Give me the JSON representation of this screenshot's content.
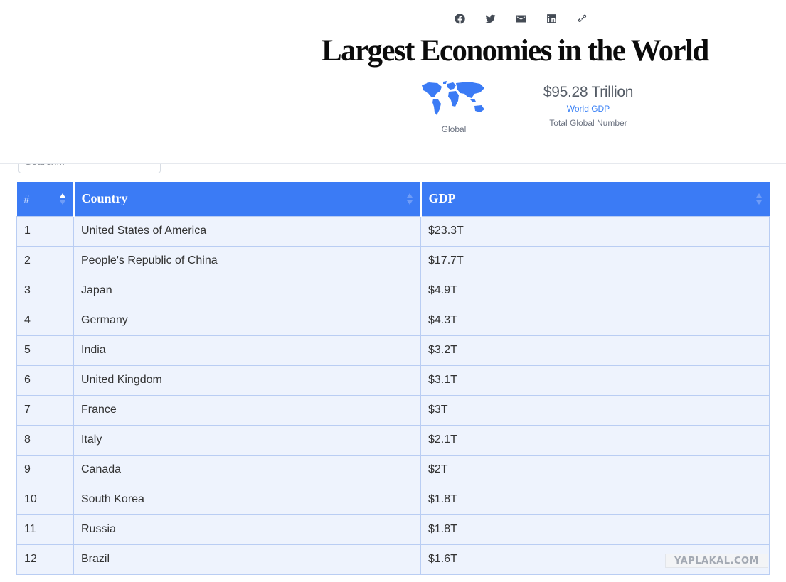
{
  "header": {
    "title": "Largest Economies in the World",
    "share": [
      {
        "name": "facebook-icon"
      },
      {
        "name": "twitter-icon"
      },
      {
        "name": "email-icon"
      },
      {
        "name": "linkedin-icon"
      },
      {
        "name": "link-icon"
      }
    ],
    "map_caption": "Global",
    "stat_value": "$95.28 Trillion",
    "stat_link": "World GDP",
    "stat_note": "Total Global Number"
  },
  "search": {
    "placeholder": "Search..."
  },
  "table": {
    "columns": [
      "#",
      "Country",
      "GDP"
    ],
    "rows": [
      [
        "1",
        "United States of America",
        "$23.3T"
      ],
      [
        "2",
        "People's Republic of China",
        "$17.7T"
      ],
      [
        "3",
        "Japan",
        "$4.9T"
      ],
      [
        "4",
        "Germany",
        "$4.3T"
      ],
      [
        "5",
        "India",
        "$3.2T"
      ],
      [
        "6",
        "United Kingdom",
        "$3.1T"
      ],
      [
        "7",
        "France",
        "$3T"
      ],
      [
        "8",
        "Italy",
        "$2.1T"
      ],
      [
        "9",
        "Canada",
        "$2T"
      ],
      [
        "10",
        "South Korea",
        "$1.8T"
      ],
      [
        "11",
        "Russia",
        "$1.8T"
      ],
      [
        "12",
        "Brazil",
        "$1.6T"
      ]
    ]
  },
  "watermark": "YAPLAKAL.COM",
  "colors": {
    "accent": "#3b7bf5",
    "row_bg": "#eef3fd",
    "row_border": "#b9cdf3",
    "link": "#3b82f6"
  }
}
